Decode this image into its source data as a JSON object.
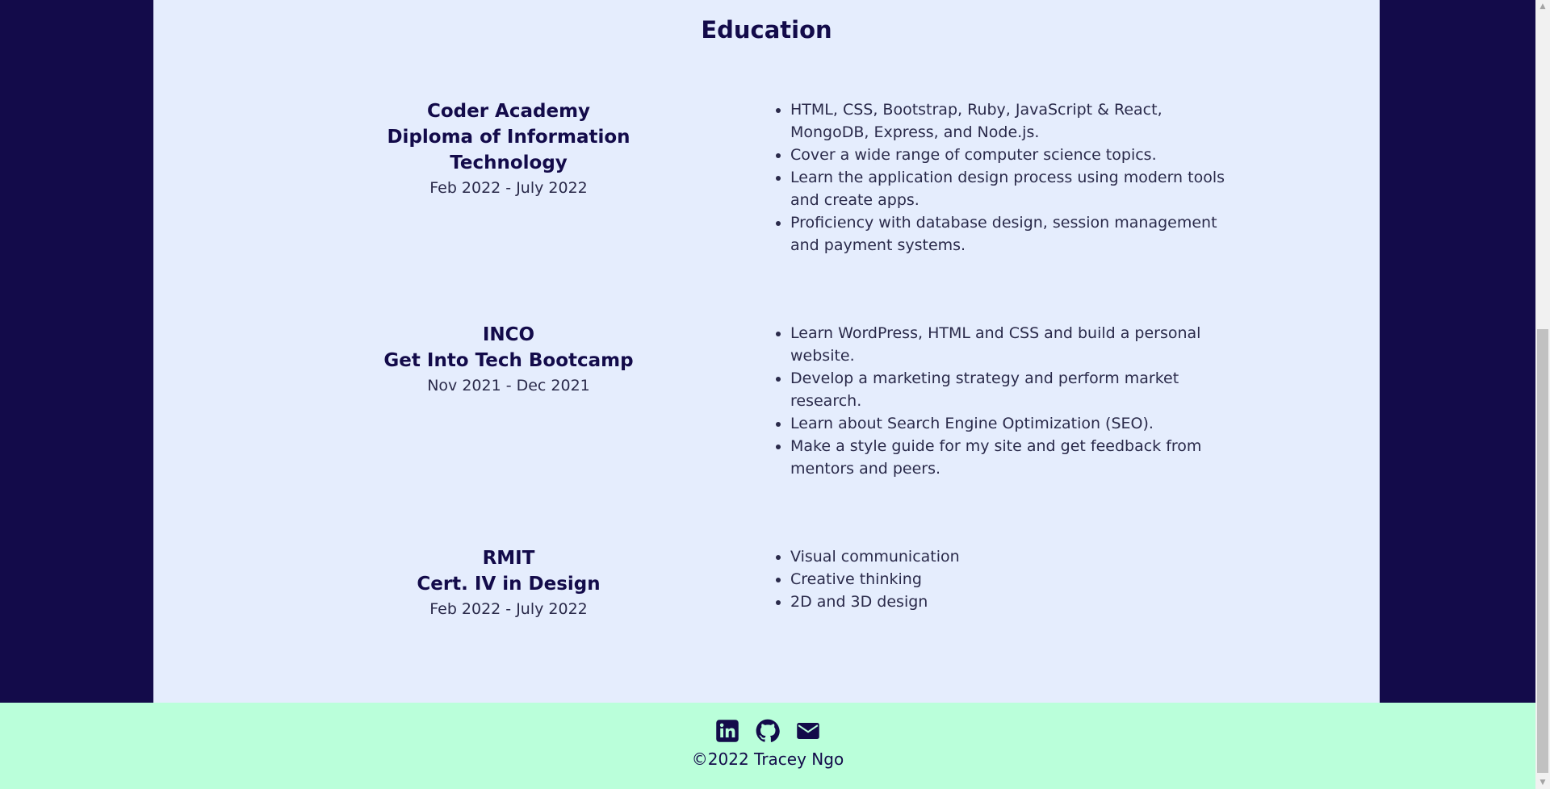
{
  "education": {
    "title": "Education",
    "entries": [
      {
        "school": "Coder Academy",
        "course": "Diploma of Information Technology",
        "dates": "Feb 2022 - July 2022",
        "points": [
          "HTML, CSS, Bootstrap, Ruby, JavaScript & React, MongoDB, Express, and Node.js.",
          "Cover a wide range of computer science topics.",
          "Learn the application design process using modern tools and create apps.",
          "Proficiency with database design, session management and payment systems."
        ]
      },
      {
        "school": "INCO",
        "course": "Get Into Tech Bootcamp",
        "dates": "Nov 2021 - Dec 2021",
        "points": [
          "Learn WordPress, HTML and CSS and build a personal website.",
          "Develop a marketing strategy and perform market research.",
          "Learn about Search Engine Optimization (SEO).",
          "Make a style guide for my site and get feedback from mentors and peers."
        ]
      },
      {
        "school": "RMIT",
        "course": "Cert. IV in Design",
        "dates": "Feb 2022 - July 2022",
        "points": [
          "Visual communication",
          "Creative thinking",
          "2D and 3D design"
        ]
      }
    ]
  },
  "footer": {
    "icons": [
      "linkedin-icon",
      "github-icon",
      "envelope-icon"
    ],
    "copyright": "©2022 Tracey Ngo"
  },
  "colors": {
    "page_background": "#130b4a",
    "panel_background": "#e5edfd",
    "footer_background": "#baffda",
    "heading_text": "#130b4a"
  }
}
